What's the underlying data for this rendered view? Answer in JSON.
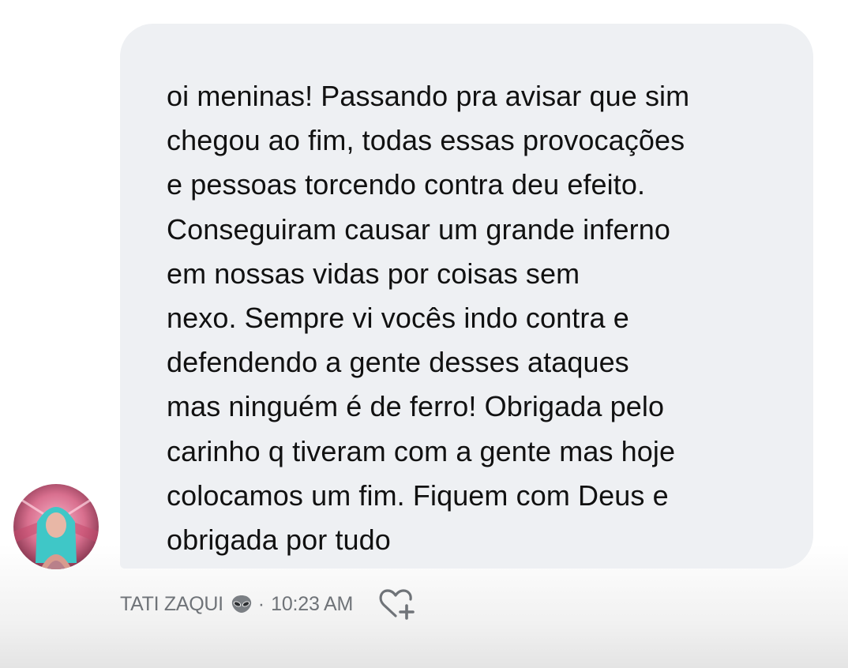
{
  "message": {
    "text": "oi meninas! Passando pra avisar que sim\nchegou ao fim, todas essas provocações\ne pessoas torcendo contra deu efeito.\nConseguiram causar um grande inferno\nem nossas vidas por coisas sem\nnexo. Sempre vi vocês indo contra e\ndefendendo a gente desses ataques\nmas ninguém é de ferro! Obrigada pelo\ncarinho q tiveram com a gente mas hoje\ncolocamos um fim. Fiquem com Deus e\nobrigada por tudo"
  },
  "meta": {
    "sender": "TATI ZAQUI",
    "separator": "·",
    "time": "10:23 AM"
  },
  "icons": {
    "sender_badge": "alien-icon",
    "like": "heart-plus-icon",
    "avatar": "profile-photo"
  },
  "colors": {
    "bubble": "#eef0f3",
    "text": "#111111",
    "meta": "#6f7378"
  }
}
